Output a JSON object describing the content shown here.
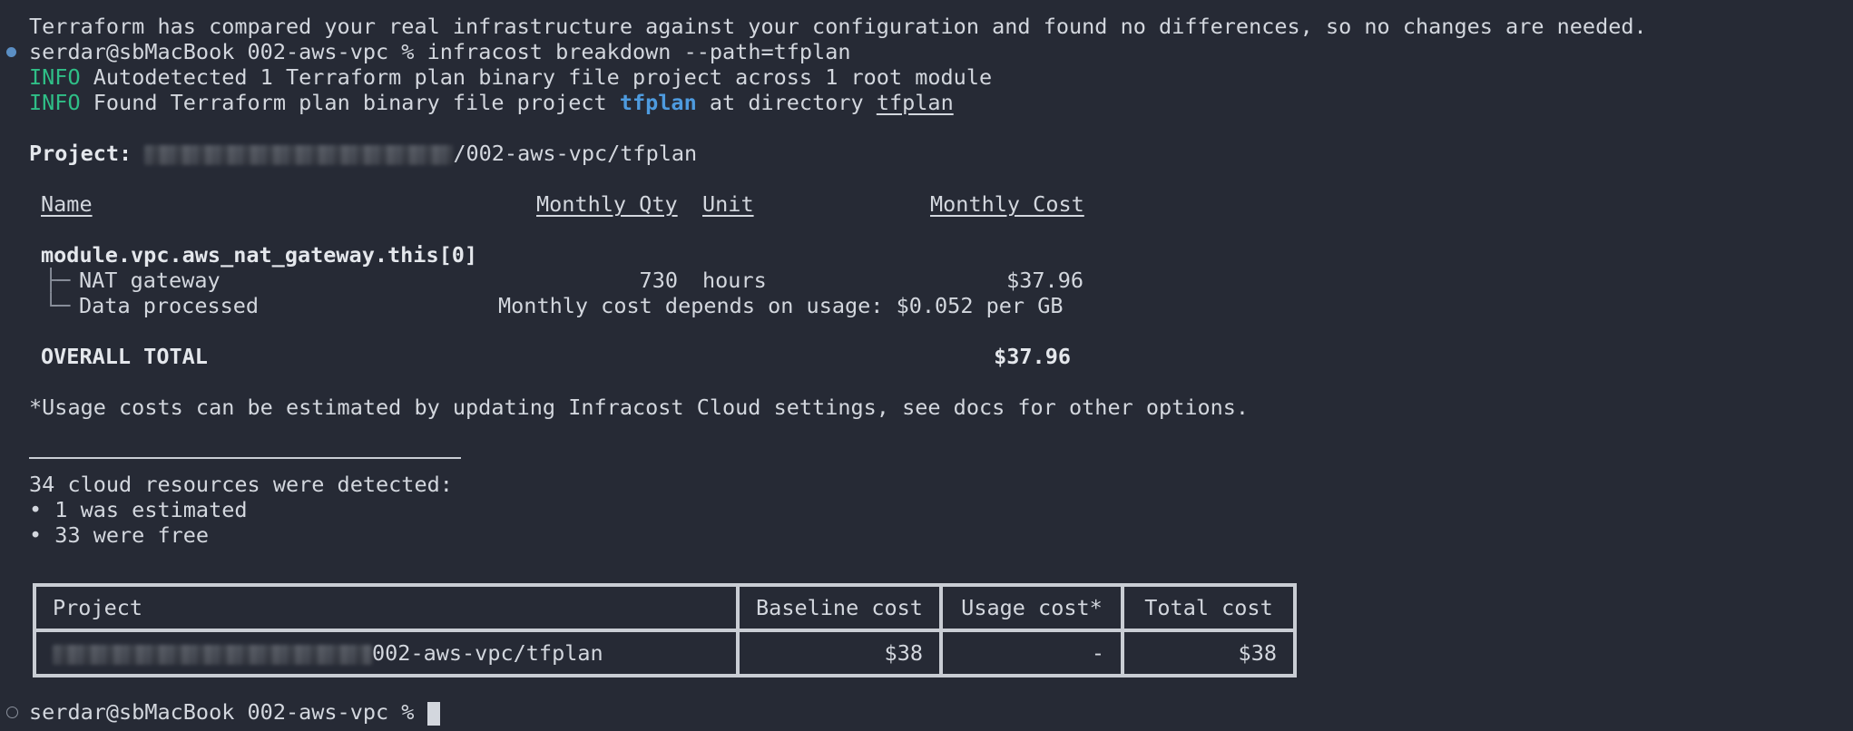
{
  "terminal": {
    "plan_message": "Terraform has compared your real infrastructure against your configuration and found no differences, so no changes are needed.",
    "prompt": "serdar@sbMacBook 002-aws-vpc %",
    "command": "infracost breakdown --path=tfplan",
    "info_label": "INFO",
    "info1": "Autodetected 1 Terraform plan binary file project across 1 root module",
    "info2_prefix": "Found Terraform plan binary file project",
    "info2_project": "tfplan",
    "info2_middle": "at directory",
    "info2_dir": "tfplan"
  },
  "breakdown": {
    "project_label": "Project:",
    "project_path_suffix": "/002-aws-vpc/tfplan",
    "headers": {
      "name": "Name",
      "qty": "Monthly Qty",
      "unit": "Unit",
      "cost": "Monthly Cost"
    },
    "resource": "module.vpc.aws_nat_gateway.this[0]",
    "rows": [
      {
        "tree": "├─",
        "name": "NAT gateway",
        "qty": "730",
        "unit": "hours",
        "cost": "$37.96"
      },
      {
        "tree": "└─",
        "name": "Data processed",
        "usage_note": "Monthly cost depends on usage: $0.052 per GB"
      }
    ],
    "overall_label": "OVERALL TOTAL",
    "overall_value": "$37.96",
    "usage_note": "*Usage costs can be estimated by updating Infracost Cloud settings, see docs for other options."
  },
  "resources": {
    "detected": "34 cloud resources were detected:",
    "estimated": "• 1 was estimated",
    "free": "• 33 were free"
  },
  "summary_table": {
    "headers": [
      "Project",
      "Baseline cost",
      "Usage cost*",
      "Total cost"
    ],
    "row": {
      "project_suffix": "002-aws-vpc/tfplan",
      "baseline": "$38",
      "usage": "-",
      "total": "$38"
    }
  }
}
